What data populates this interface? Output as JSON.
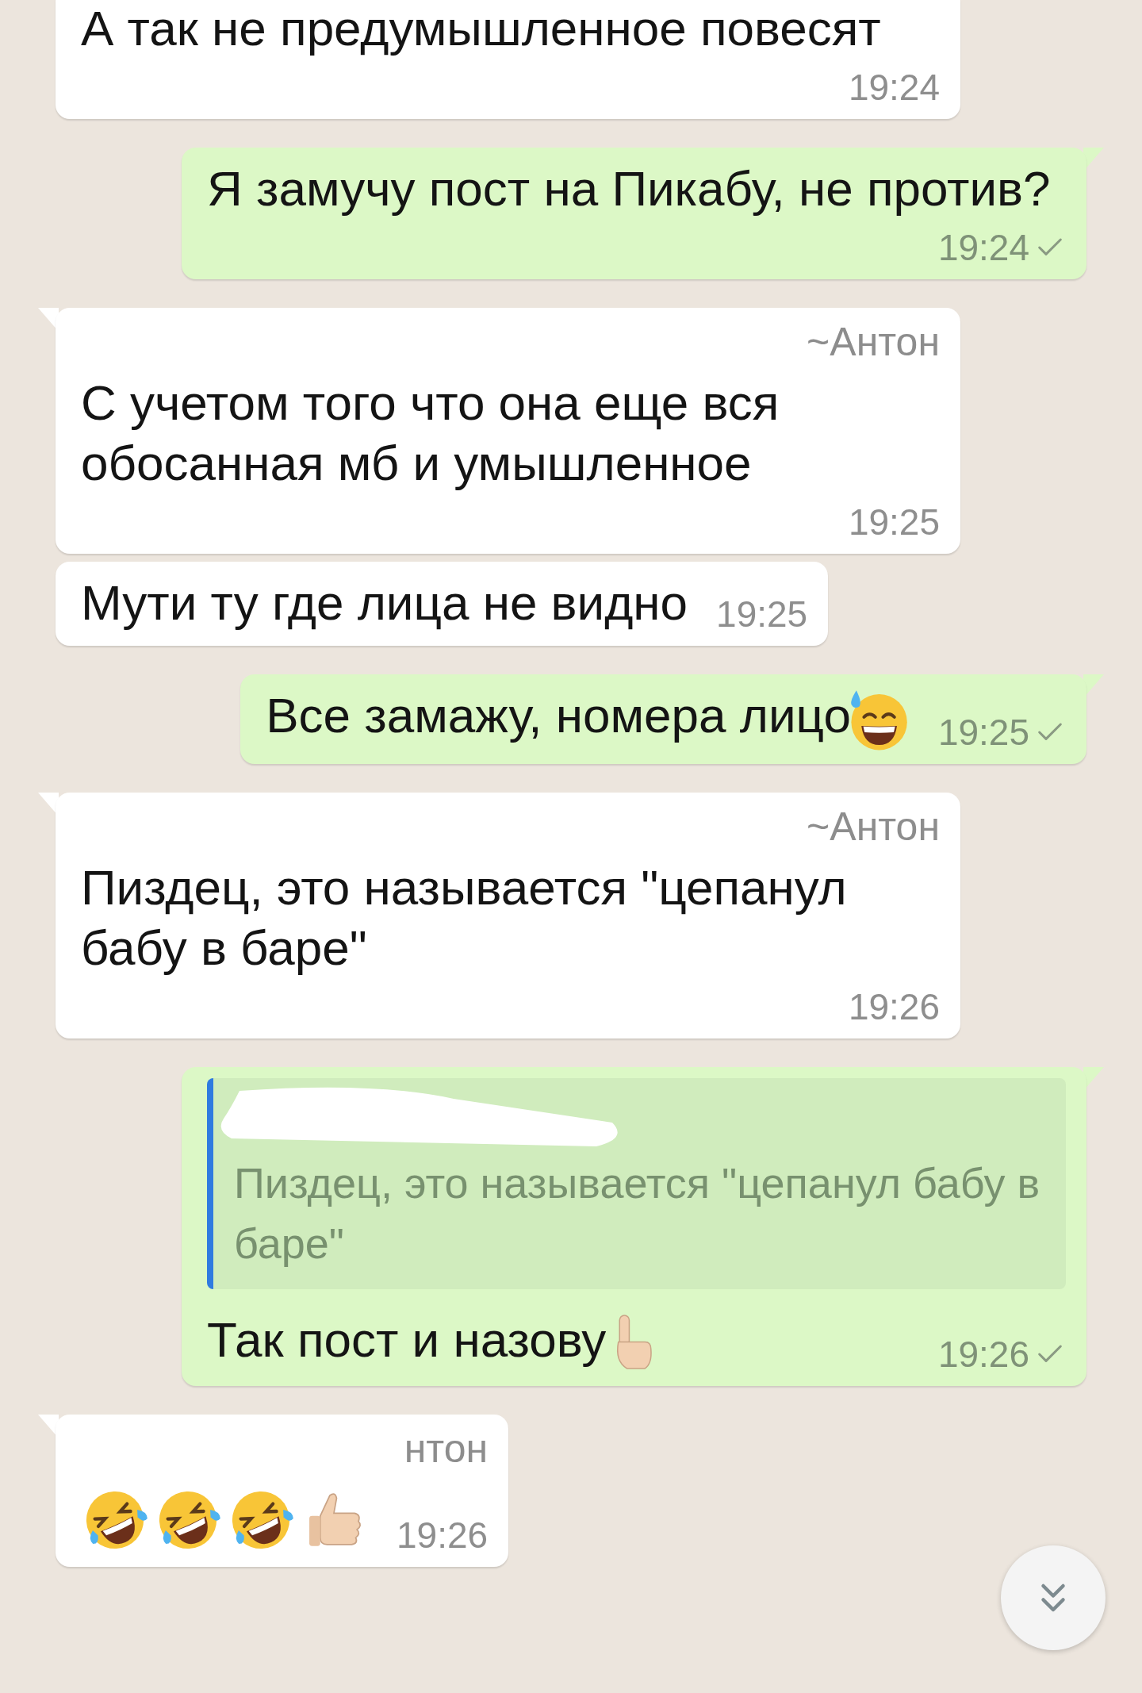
{
  "messages": [
    {
      "outgoing": false,
      "kind": "text",
      "tail": false,
      "text": "А так не предумышленное повесят",
      "time": "19:24"
    },
    {
      "outgoing": true,
      "kind": "text",
      "tail": true,
      "text": "Я замучу пост на Пикабу, не против?",
      "time": "19:24",
      "sent": true
    },
    {
      "outgoing": false,
      "kind": "text",
      "tail": true,
      "sender": "~Антон",
      "text": "С учетом того что она еще вся обосанная мб и умышленное",
      "time": "19:25"
    },
    {
      "outgoing": false,
      "kind": "text",
      "tail": false,
      "text": "Мути ту где лица не видно",
      "time": "19:25"
    },
    {
      "outgoing": true,
      "kind": "text_with_emoji",
      "tail": true,
      "text": "Все замажу, номера лицо",
      "time": "19:25",
      "sent": true
    },
    {
      "outgoing": false,
      "kind": "text",
      "tail": true,
      "sender": "~Антон",
      "text": "Пиздец, это называется \"цепанул бабу в баре\"",
      "time": "19:26"
    },
    {
      "outgoing": true,
      "kind": "reply",
      "tail": true,
      "quote": "Пиздец, это называется \"цепанул бабу в баре\"",
      "text": "Так пост и назову",
      "time": "19:26",
      "sent": true
    },
    {
      "outgoing": false,
      "kind": "emoji_row",
      "tail": true,
      "sender": "нтон",
      "time": "19:26"
    }
  ]
}
